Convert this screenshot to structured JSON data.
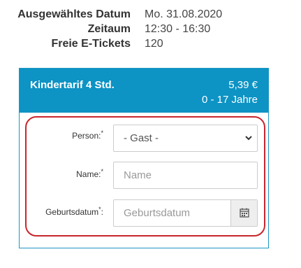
{
  "booking_info": {
    "date_label": "Ausgewähltes Datum",
    "date_value": "Mo. 31.08.2020",
    "time_label": "Zeitaum",
    "time_value": "12:30 - 16:30",
    "tickets_label": "Freie E-Tickets",
    "tickets_value": "120"
  },
  "tarif": {
    "name": "Kindertarif 4 Std.",
    "price": "5,39 €",
    "age_range": "0 - 17 Jahre",
    "header_color": "#0d93c4"
  },
  "form": {
    "person_label": "Person:",
    "person_required": "*",
    "person_selected": "- Gast -",
    "name_label": "Name:",
    "name_required": "*",
    "name_placeholder": "Name",
    "birthdate_label": "Geburtsdatum",
    "birthdate_required": "*",
    "birthdate_colon": ":",
    "birthdate_placeholder": "Geburtsdatum",
    "calendar_icon": "calendar-icon",
    "chevron_icon": "chevron-down-icon",
    "highlight_color": "#c8262b"
  }
}
